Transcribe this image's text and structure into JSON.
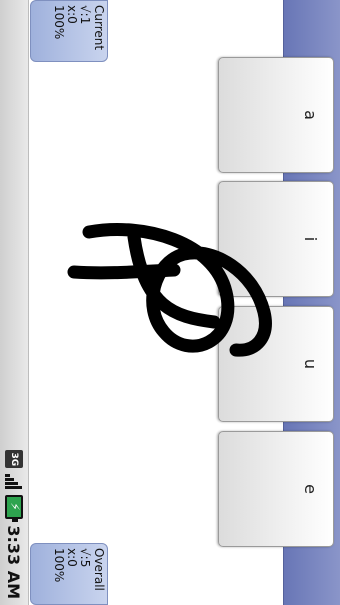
{
  "status_bar": {
    "time": "3:33 AM",
    "network": "3G",
    "icons": [
      "3g-icon",
      "signal-icon",
      "battery-charging-icon"
    ]
  },
  "score_current": {
    "title": "Current",
    "correct": "√:1",
    "wrong": "x:0",
    "percent": "100%"
  },
  "score_overall": {
    "title": "Overall",
    "correct": "√:5",
    "wrong": "x:0",
    "percent": "100%"
  },
  "answers": {
    "a": "a",
    "i": "i",
    "u": "u",
    "e": "e"
  },
  "colors": {
    "rail": "#7a86c0",
    "status_bar": "#dcdcdc",
    "score_panel": "#b6c3e6"
  }
}
